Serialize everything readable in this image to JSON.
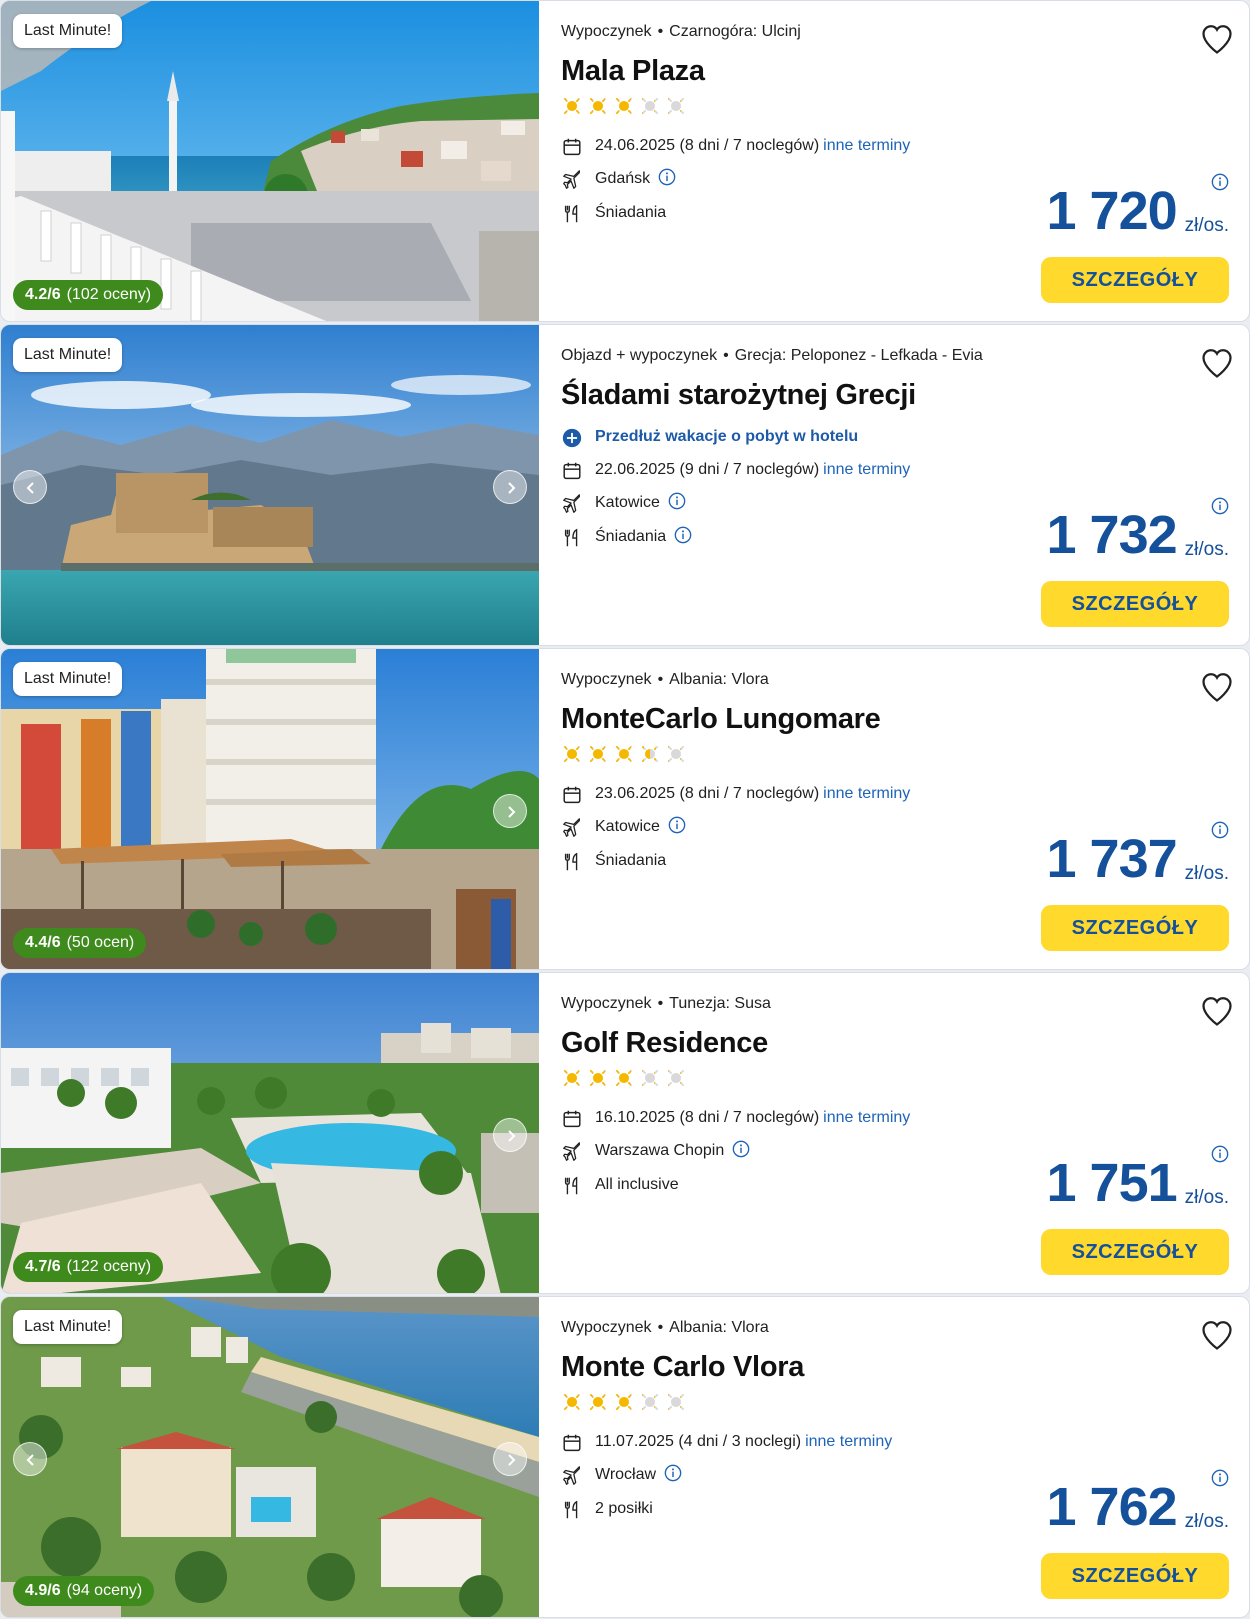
{
  "offers": [
    {
      "badge": "Last Minute!",
      "rating_score": "4.2/6",
      "rating_count": "(102 oceny)",
      "type": "Wypoczynek",
      "location": "Czarnogóra: Ulcinj",
      "title": "Mala Plaza",
      "stars": 3,
      "extend": "",
      "date": "24.06.2025 (8 dni / 7 noclegów)",
      "other_dates": "inne terminy",
      "airport": "Gdańsk",
      "board": "Śniadania",
      "price": "1 720",
      "unit": "zł/os.",
      "button": "SZCZEGÓŁY"
    },
    {
      "badge": "Last Minute!",
      "rating_score": "",
      "rating_count": "",
      "type": "Objazd + wypoczynek",
      "location": "Grecja: Peloponez - Lefkada - Evia",
      "title": "Śladami starożytnej Grecji",
      "stars": 0,
      "extend": "Przedłuż wakacje o pobyt w hotelu",
      "date": "22.06.2025 (9 dni / 7 noclegów)",
      "other_dates": "inne terminy",
      "airport": "Katowice",
      "board": "Śniadania",
      "price": "1 732",
      "unit": "zł/os.",
      "button": "SZCZEGÓŁY"
    },
    {
      "badge": "Last Minute!",
      "rating_score": "4.4/6",
      "rating_count": "(50 ocen)",
      "type": "Wypoczynek",
      "location": "Albania: Vlora",
      "title": "MonteCarlo Lungomare",
      "stars": 3.5,
      "extend": "",
      "date": "23.06.2025 (8 dni / 7 noclegów)",
      "other_dates": "inne terminy",
      "airport": "Katowice",
      "board": "Śniadania",
      "price": "1 737",
      "unit": "zł/os.",
      "button": "SZCZEGÓŁY"
    },
    {
      "badge": "",
      "rating_score": "4.7/6",
      "rating_count": "(122 oceny)",
      "type": "Wypoczynek",
      "location": "Tunezja: Susa",
      "title": "Golf Residence",
      "stars": 3,
      "extend": "",
      "date": "16.10.2025 (8 dni / 7 noclegów)",
      "other_dates": "inne terminy",
      "airport": "Warszawa Chopin",
      "board": "All inclusive",
      "price": "1 751",
      "unit": "zł/os.",
      "button": "SZCZEGÓŁY"
    },
    {
      "badge": "Last Minute!",
      "rating_score": "4.9/6",
      "rating_count": "(94 oceny)",
      "type": "Wypoczynek",
      "location": "Albania: Vlora",
      "title": "Monte Carlo Vlora",
      "stars": 3,
      "extend": "",
      "date": "11.07.2025 (4 dni / 3 noclegi)",
      "other_dates": "inne terminy",
      "airport": "Wrocław",
      "board": "2 posiłki",
      "price": "1 762",
      "unit": "zł/os.",
      "button": "SZCZEGÓŁY"
    }
  ],
  "icons": {
    "calendar": "calendar-icon",
    "plane": "plane-icon",
    "board": "cutlery-icon",
    "info": "info-icon",
    "favorite": "heart-icon",
    "star": "sun-star-icon",
    "extend": "plus-circle-icon"
  },
  "colors": {
    "price": "#15509a",
    "link": "#1d63b8",
    "button": "#ffd92b",
    "rating_badge": "#3f8a1c",
    "star_full": "#f5b800",
    "star_empty": "#d9d9d9"
  }
}
